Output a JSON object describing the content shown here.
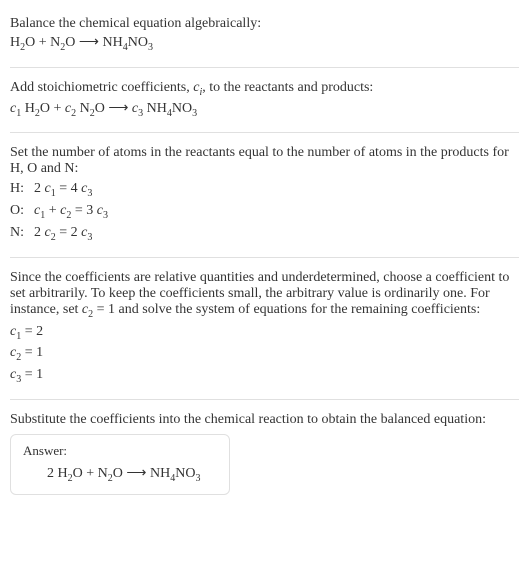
{
  "section1": {
    "line1": "Balance the chemical equation algebraically:",
    "eq": {
      "h2o": "H",
      "h2o_sub": "2",
      "h2o_o": "O",
      "plus1": " + ",
      "n2o": "N",
      "n2o_sub": "2",
      "n2o_o": "O",
      "arrow": " ⟶ ",
      "nh4": "NH",
      "nh4_sub": "4",
      "no3": "NO",
      "no3_sub": "3"
    }
  },
  "section2": {
    "line1a": "Add stoichiometric coefficients, ",
    "line1b_c": "c",
    "line1b_i": "i",
    "line1c": ", to the reactants and products:",
    "c1": "c",
    "c1_sub": "1",
    "c2": "c",
    "c2_sub": "2",
    "c3": "c",
    "c3_sub": "3",
    "sp": " ",
    "h2o": "H",
    "h2o_sub": "2",
    "h2o_o": "O",
    "plus1": " + ",
    "n2o": "N",
    "n2o_sub": "2",
    "n2o_o": "O",
    "arrow": " ⟶ ",
    "nh4": "NH",
    "nh4_sub": "4",
    "no3": "NO",
    "no3_sub": "3"
  },
  "section3": {
    "line1": "Set the number of atoms in the reactants equal to the number of atoms in the products for H, O and N:",
    "rows": {
      "h_label": "H:",
      "h_eq_a": "2 ",
      "h_eq_c1": "c",
      "h_eq_c1s": "1",
      "h_eq_mid": " = 4 ",
      "h_eq_c3": "c",
      "h_eq_c3s": "3",
      "o_label": "O:",
      "o_eq_c1": "c",
      "o_eq_c1s": "1",
      "o_eq_plus": " + ",
      "o_eq_c2": "c",
      "o_eq_c2s": "2",
      "o_eq_mid": " = 3 ",
      "o_eq_c3": "c",
      "o_eq_c3s": "3",
      "n_label": "N:",
      "n_eq_a": "2 ",
      "n_eq_c2": "c",
      "n_eq_c2s": "2",
      "n_eq_mid": " = 2 ",
      "n_eq_c3": "c",
      "n_eq_c3s": "3"
    }
  },
  "section4": {
    "line1a": "Since the coefficients are relative quantities and underdetermined, choose a coefficient to set arbitrarily. To keep the coefficients small, the arbitrary value is ordinarily one. For instance, set ",
    "line1_c2": "c",
    "line1_c2s": "2",
    "line1b": " = 1 and solve the system of equations for the remaining coefficients:",
    "c1": "c",
    "c1s": "1",
    "c1v": " = 2",
    "c2": "c",
    "c2s": "2",
    "c2v": " = 1",
    "c3": "c",
    "c3s": "3",
    "c3v": " = 1"
  },
  "section5": {
    "line1": "Substitute the coefficients into the chemical reaction to obtain the balanced equation:",
    "answer_label": "Answer:",
    "eq": {
      "two": "2 ",
      "h2o": "H",
      "h2o_sub": "2",
      "h2o_o": "O",
      "plus1": " + ",
      "n2o": "N",
      "n2o_sub": "2",
      "n2o_o": "O",
      "arrow": " ⟶ ",
      "nh4": "NH",
      "nh4_sub": "4",
      "no3": "NO",
      "no3_sub": "3"
    }
  }
}
